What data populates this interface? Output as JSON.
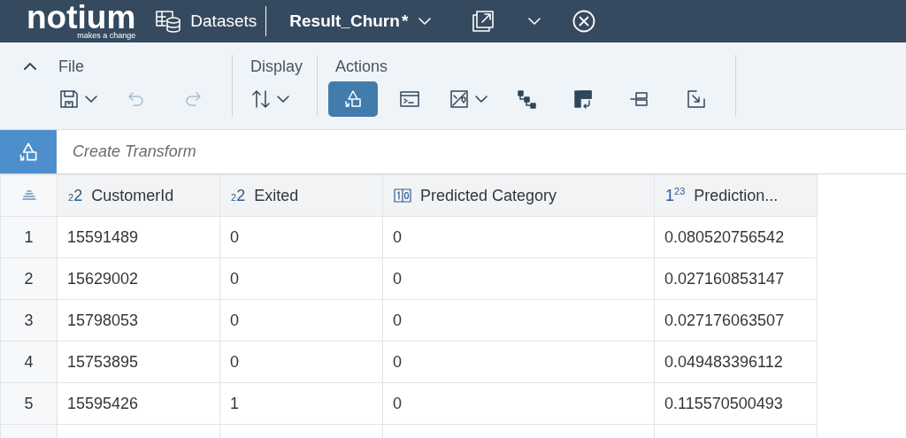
{
  "header": {
    "logo": "notium",
    "tagline": "makes a change",
    "nav": "Datasets",
    "document": "Result_Churn",
    "modified_mark": "*"
  },
  "toolbar": {
    "expanded": true,
    "groups": [
      {
        "title": "File",
        "buttons": [
          {
            "selected": false,
            "disabled": false,
            "menu": true
          },
          {
            "selected": false,
            "disabled": true,
            "menu": false
          },
          {
            "selected": false,
            "disabled": true,
            "menu": false
          }
        ]
      },
      {
        "title": "Display",
        "buttons": [
          {
            "selected": false,
            "disabled": false,
            "menu": true
          }
        ]
      },
      {
        "title": "Actions",
        "buttons": [
          {
            "selected": true,
            "disabled": false,
            "menu": false
          },
          {
            "selected": false,
            "disabled": false,
            "menu": false
          },
          {
            "selected": false,
            "disabled": false,
            "menu": true
          },
          {
            "selected": false,
            "disabled": false,
            "menu": false
          },
          {
            "selected": false,
            "disabled": false,
            "menu": false
          },
          {
            "selected": false,
            "disabled": false,
            "menu": false
          },
          {
            "selected": false,
            "disabled": false,
            "menu": false
          }
        ]
      }
    ]
  },
  "transform": {
    "placeholder": "Create Transform"
  },
  "table": {
    "columns": [
      {
        "kind": "integer",
        "type_mark": "$_{2}$2",
        "label": "CustomerId"
      },
      {
        "kind": "integer",
        "type_mark": "$_{2}$2",
        "label": "Exited"
      },
      {
        "kind": "category",
        "label": "Predicted Category"
      },
      {
        "kind": "decimal",
        "type_mark": "1$^{23}$",
        "label": "Prediction..."
      }
    ],
    "rows": [
      {
        "number": "1",
        "cells": [
          "15591489",
          "0",
          "0",
          "0.080520756542"
        ]
      },
      {
        "number": "2",
        "cells": [
          "15629002",
          "0",
          "0",
          "0.027160853147"
        ]
      },
      {
        "number": "3",
        "cells": [
          "15798053",
          "0",
          "0",
          "0.027176063507"
        ]
      },
      {
        "number": "4",
        "cells": [
          "15753895",
          "0",
          "0",
          "0.049483396112"
        ]
      },
      {
        "number": "5",
        "cells": [
          "15595426",
          "1",
          "0",
          "0.115570500493"
        ]
      }
    ]
  }
}
